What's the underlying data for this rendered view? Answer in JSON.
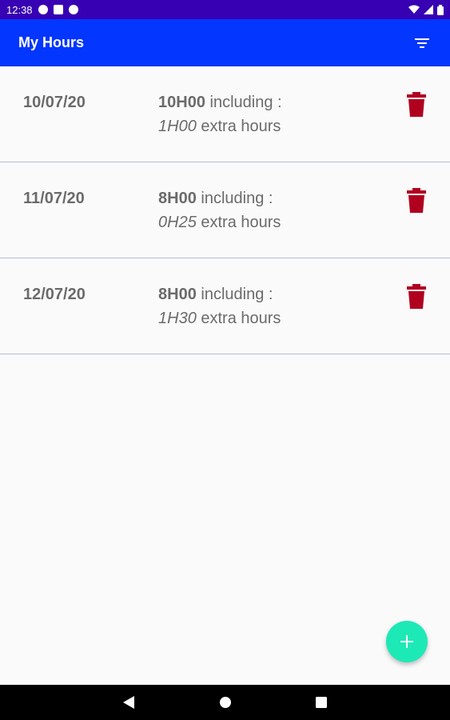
{
  "status_bar": {
    "time": "12:38",
    "icons": [
      "notification-p-icon",
      "sd-card-icon",
      "notification-p-icon",
      "wifi-icon",
      "signal-icon",
      "battery-icon"
    ]
  },
  "app_bar": {
    "title": "My Hours",
    "filter_icon": "filter-icon",
    "background": "#0336ff"
  },
  "entries": [
    {
      "date": "10/07/20",
      "total": "10H00",
      "including": "including :",
      "extra": "1H00",
      "extra_label": "extra hours"
    },
    {
      "date": "11/07/20",
      "total": "8H00",
      "including": "including :",
      "extra": "0H25",
      "extra_label": "extra hours"
    },
    {
      "date": "12/07/20",
      "total": "8H00",
      "including": "including :",
      "extra": "1H30",
      "extra_label": "extra hours"
    }
  ],
  "colors": {
    "status_bar": "#3700b3",
    "app_bar": "#0336ff",
    "delete": "#b00020",
    "fab": "#1de9b6",
    "divider": "#b4b8f0"
  },
  "fab": {
    "icon": "plus-icon"
  },
  "nav_bar": {
    "icons": [
      "back-icon",
      "home-icon",
      "recents-icon"
    ]
  }
}
